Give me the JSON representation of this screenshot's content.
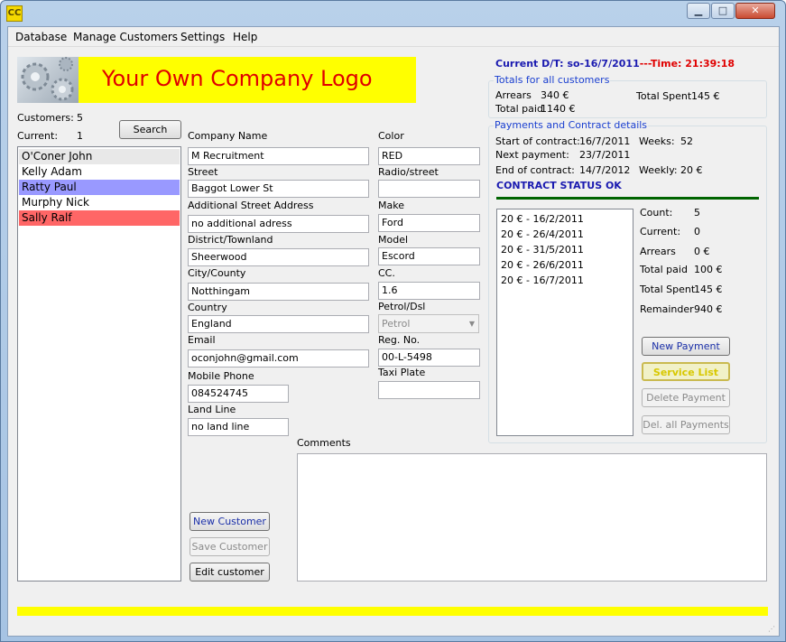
{
  "window": {
    "app_icon_text": "CC",
    "minimize_glyph": "▁",
    "maximize_glyph": "□",
    "close_glyph": "✕"
  },
  "menu": [
    "Database",
    "Manage Customers",
    "Settings",
    "Help"
  ],
  "logo": {
    "text": "Your Own Company Logo"
  },
  "datetime": {
    "label": "Current D/T:",
    "date": "so-16/7/2011",
    "separator": "---",
    "time_label": "Time:",
    "time": "21:39:18"
  },
  "customers": {
    "count_label": "Customers:",
    "count": "5",
    "current_label": "Current:",
    "current": "1",
    "search_label": "Search",
    "list": [
      {
        "name": "O'Coner John",
        "color": "#e8e8e8"
      },
      {
        "name": "Kelly Adam",
        "color": "#ffffff"
      },
      {
        "name": "Ratty Paul",
        "color": "#9999ff"
      },
      {
        "name": "Murphy Nick",
        "color": "#ffffff"
      },
      {
        "name": "Sally Ralf",
        "color": "#ff6666"
      }
    ]
  },
  "form": {
    "company_name_label": "Company Name",
    "company_name": "M Recruitment",
    "street_label": "Street",
    "street": "Baggot Lower St",
    "add_street_label": "Additional Street Address",
    "add_street": "no additional adress",
    "district_label": "District/Townland",
    "district": "Sheerwood",
    "city_label": "City/County",
    "city": "Notthingam",
    "country_label": "Country",
    "country": "England",
    "email_label": "Email",
    "email": "oconjohn@gmail.com",
    "mobile_label": "Mobile Phone",
    "mobile": "084524745",
    "landline_label": "Land Line",
    "landline": "no land line",
    "color_label": "Color",
    "color": "RED",
    "radio_label": "Radio/street",
    "radio": "",
    "make_label": "Make",
    "make": "Ford",
    "model_label": "Model",
    "model": "Escord",
    "cc_label": "CC.",
    "cc": "1.6",
    "fuel_label": "Petrol/Dsl",
    "fuel": "Petrol",
    "reg_label": "Reg. No.",
    "reg": "00-L-5498",
    "taxi_label": "Taxi Plate",
    "taxi": "",
    "comments_label": "Comments",
    "comments": ""
  },
  "buttons": {
    "new_customer": "New Customer",
    "save_customer": "Save Customer",
    "edit_customer": "Edit customer",
    "new_payment": "New Payment",
    "service_list": "Service List",
    "delete_payment": "Delete Payment",
    "delete_all": "Del. all Payments"
  },
  "totals": {
    "title": "Totals for all customers",
    "arrears_label": "Arrears",
    "arrears": "340 €",
    "total_paid_label": "Total paid",
    "total_paid": "1140 €",
    "total_spent_label": "Total Spent",
    "total_spent": "145 €"
  },
  "contract": {
    "title": "Payments and Contract details",
    "start_label": "Start of contract:",
    "start": "16/7/2011",
    "next_label": "Next payment:",
    "next": "23/7/2011",
    "end_label": "End of contract:",
    "end": "14/7/2012",
    "weeks_label": "Weeks:",
    "weeks": "52",
    "weekly_label": "Weekly:",
    "weekly": "20 €",
    "status": "CONTRACT STATUS OK",
    "status_color": "#006400"
  },
  "payments": [
    "20 € - 16/2/2011",
    "20 € - 26/4/2011",
    "20 € - 31/5/2011",
    "20 € - 26/6/2011",
    "20 € - 16/7/2011"
  ],
  "payment_stats": {
    "count_label": "Count:",
    "count": "5",
    "current_label": "Current:",
    "current": "0",
    "arrears_label": "Arrears",
    "arrears": "0 €",
    "total_paid_label": "Total paid",
    "total_paid": "100 €",
    "total_spent_label": "Total Spent",
    "total_spent": "145 €",
    "remainder_label": "Remainder",
    "remainder": "940 €"
  }
}
